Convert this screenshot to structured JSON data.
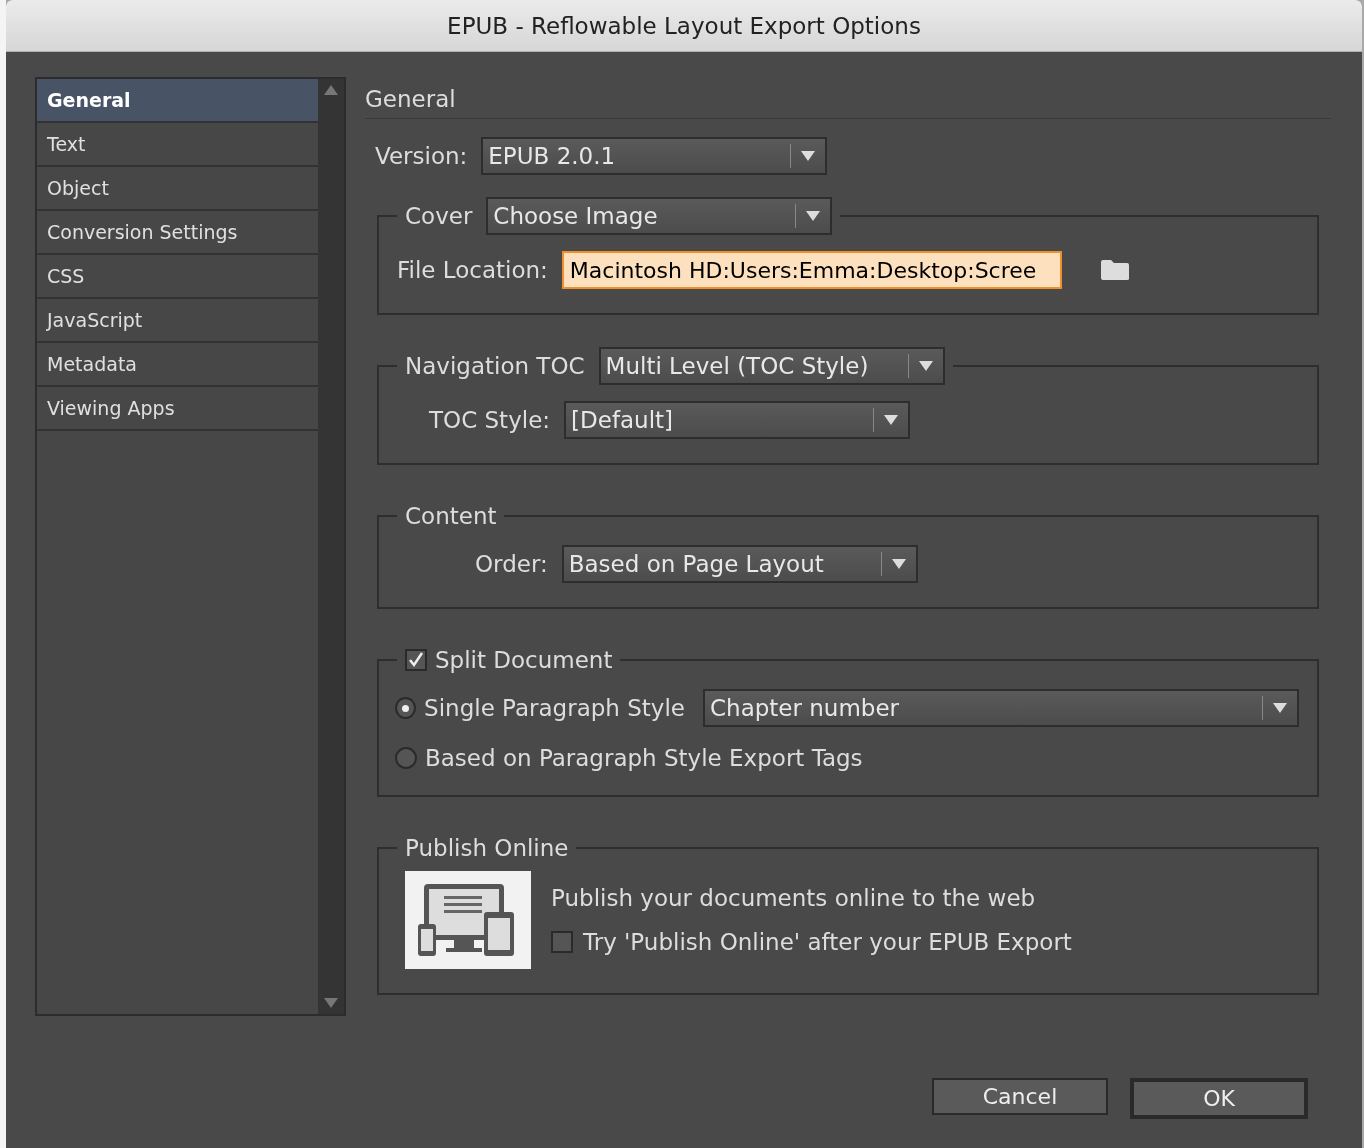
{
  "window": {
    "title": "EPUB - Reflowable Layout Export Options"
  },
  "sidebar": {
    "items": [
      {
        "label": "General",
        "selected": true
      },
      {
        "label": "Text",
        "selected": false
      },
      {
        "label": "Object",
        "selected": false
      },
      {
        "label": "Conversion Settings",
        "selected": false
      },
      {
        "label": "CSS",
        "selected": false
      },
      {
        "label": "JavaScript",
        "selected": false
      },
      {
        "label": "Metadata",
        "selected": false
      },
      {
        "label": "Viewing Apps",
        "selected": false
      }
    ]
  },
  "panel": {
    "heading": "General",
    "version": {
      "label": "Version:",
      "value": "EPUB 2.0.1"
    },
    "cover": {
      "label": "Cover",
      "value": "Choose Image",
      "file_label": "File Location:",
      "file_value": "Macintosh HD:Users:Emma:Desktop:Scree"
    },
    "navigation": {
      "label": "Navigation TOC",
      "value": "Multi Level (TOC Style)",
      "style_label": "TOC Style:",
      "style_value": "[Default]"
    },
    "content": {
      "label": "Content",
      "order_label": "Order:",
      "order_value": "Based on Page Layout"
    },
    "split": {
      "label": "Split Document",
      "checked": true,
      "options": [
        {
          "label": "Single Paragraph Style",
          "selected": true,
          "dropdown": "Chapter number"
        },
        {
          "label": "Based on Paragraph Style Export Tags",
          "selected": false
        }
      ]
    },
    "publish": {
      "label": "Publish Online",
      "description": "Publish your documents online to the web",
      "option": {
        "label": "Try 'Publish Online' after your EPUB Export",
        "checked": false
      }
    }
  },
  "buttons": [
    {
      "label": "Cancel",
      "default": false
    },
    {
      "label": "OK",
      "default": true
    }
  ]
}
